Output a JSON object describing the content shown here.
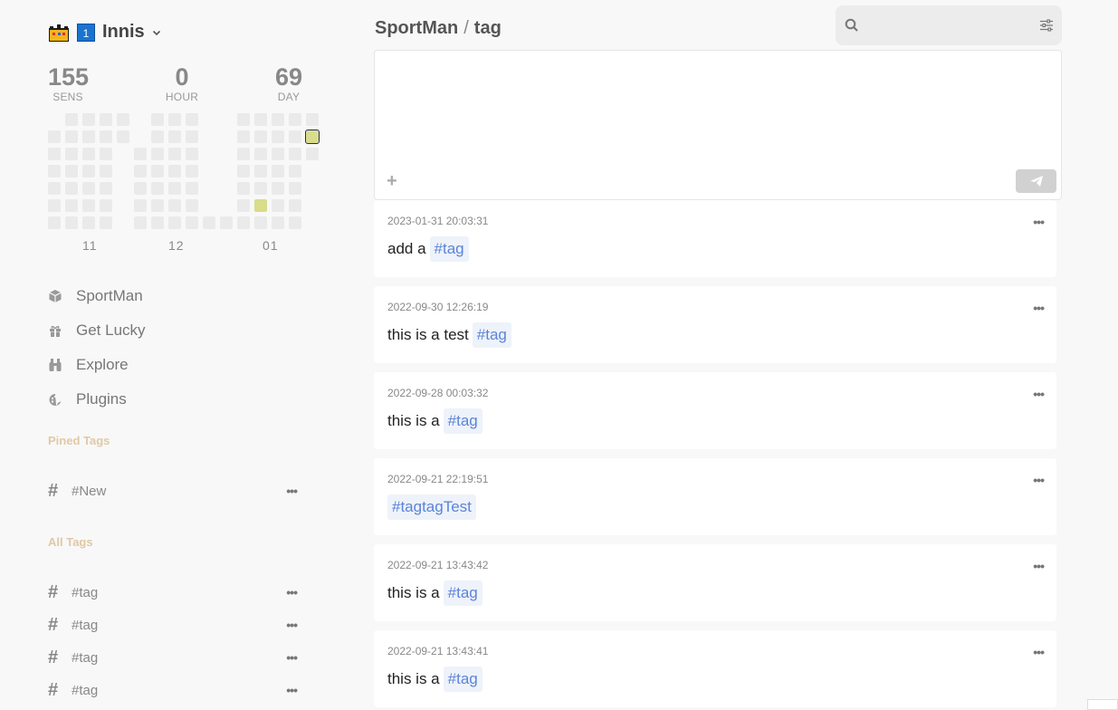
{
  "user": {
    "name": "Innis",
    "badge": "1"
  },
  "stats": [
    {
      "value": "155",
      "label": "SENS"
    },
    {
      "value": "0",
      "label": "HOUR"
    },
    {
      "value": "69",
      "label": "DAY"
    }
  ],
  "months": [
    "11",
    "12",
    "01"
  ],
  "nav": [
    {
      "label": "SportMan",
      "icon": "box-icon"
    },
    {
      "label": "Get Lucky",
      "icon": "gift-icon"
    },
    {
      "label": "Explore",
      "icon": "binoculars-icon"
    },
    {
      "label": "Plugins",
      "icon": "palette-icon"
    }
  ],
  "pinned_title": "Pined Tags",
  "pinned_tags": [
    "#New"
  ],
  "all_title": "All Tags",
  "all_tags": [
    "#tag",
    "#tag",
    "#tag",
    "#tag"
  ],
  "breadcrumb": {
    "root": "SportMan",
    "sep": "/",
    "current": "tag"
  },
  "search": {
    "placeholder": ""
  },
  "editor": {
    "placeholder": ""
  },
  "memos": [
    {
      "time": "2023-01-31 20:03:31",
      "text": "add a",
      "tag": "#tag"
    },
    {
      "time": "2022-09-30 12:26:19",
      "text": "this is a test",
      "tag": "#tag"
    },
    {
      "time": "2022-09-28 00:03:32",
      "text": "this is a",
      "tag": "#tag"
    },
    {
      "time": "2022-09-21 22:19:51",
      "text": "",
      "tag": "#tagtagTest"
    },
    {
      "time": "2022-09-21 13:43:42",
      "text": "this is a",
      "tag": "#tag"
    },
    {
      "time": "2022-09-21 13:43:41",
      "text": "this is a",
      "tag": "#tag"
    }
  ],
  "colors": {
    "heat_empty": "#eaeaea",
    "heat_active": "#d8dc8b",
    "tag_text": "#5b84d9",
    "tag_bg": "#eef2fa",
    "section_title": "#e0c9a6"
  }
}
